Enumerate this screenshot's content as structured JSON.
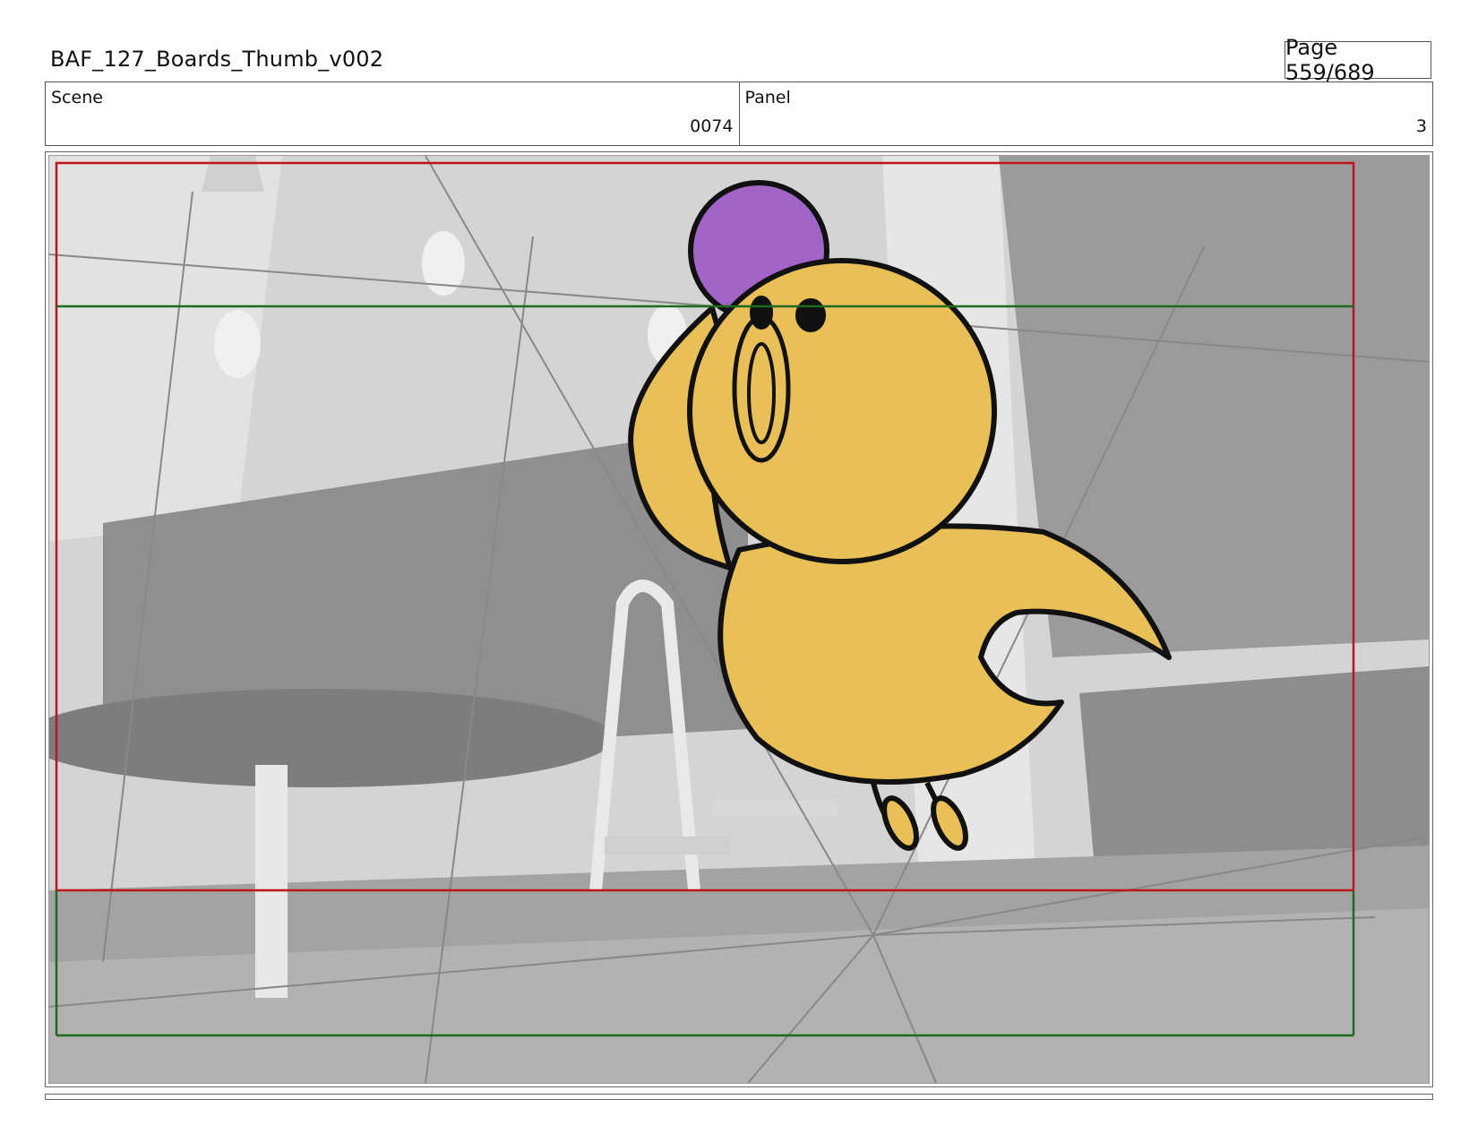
{
  "header": {
    "title": "BAF_127_Boards_Thumb_v002",
    "page": "Page 559/689"
  },
  "info": {
    "scene_label": "Scene",
    "scene_value": "0074",
    "panel_label": "Panel",
    "panel_value": "3"
  },
  "panel": {
    "safe_frame_color": "#c0141c",
    "title_safe_color": "#1e6b1e",
    "character_body_color": "#e8c056",
    "character_hat_color": "#a264c6",
    "background_tone": "#9e9e9e"
  }
}
